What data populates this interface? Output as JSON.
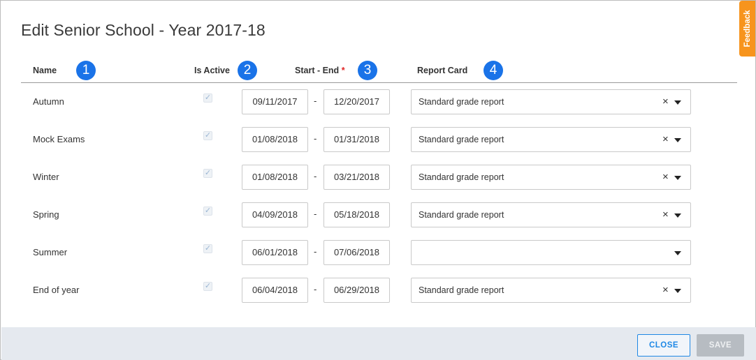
{
  "dialog": {
    "title": "Edit Senior School - Year 2017-18"
  },
  "feedback": {
    "label": "Feedback"
  },
  "columns": {
    "name": "Name",
    "is_active": "Is Active",
    "start_end": "Start - End",
    "required_mark": "*",
    "report_card": "Report Card"
  },
  "badges": [
    "1",
    "2",
    "3",
    "4"
  ],
  "date_separator": "-",
  "rows": [
    {
      "name": "Autumn",
      "active": true,
      "start": "09/11/2017",
      "end": "12/20/2017",
      "report_card": "Standard grade report"
    },
    {
      "name": "Mock Exams",
      "active": true,
      "start": "01/08/2018",
      "end": "01/31/2018",
      "report_card": "Standard grade report"
    },
    {
      "name": "Winter",
      "active": true,
      "start": "01/08/2018",
      "end": "03/21/2018",
      "report_card": "Standard grade report"
    },
    {
      "name": "Spring",
      "active": true,
      "start": "04/09/2018",
      "end": "05/18/2018",
      "report_card": "Standard grade report"
    },
    {
      "name": "Summer",
      "active": true,
      "start": "06/01/2018",
      "end": "07/06/2018",
      "report_card": ""
    },
    {
      "name": "End of year",
      "active": true,
      "start": "06/04/2018",
      "end": "06/29/2018",
      "report_card": "Standard grade report"
    }
  ],
  "icons": {
    "checkbox": "check-icon",
    "clear": "clear-icon",
    "dropdown": "chevron-down-icon"
  },
  "footer": {
    "close_label": "CLOSE",
    "save_label": "SAVE"
  },
  "colors": {
    "accent": "#1a73e8",
    "feedback": "#f7941d",
    "footer_bg": "#e5e9ef",
    "required": "#e02424"
  }
}
